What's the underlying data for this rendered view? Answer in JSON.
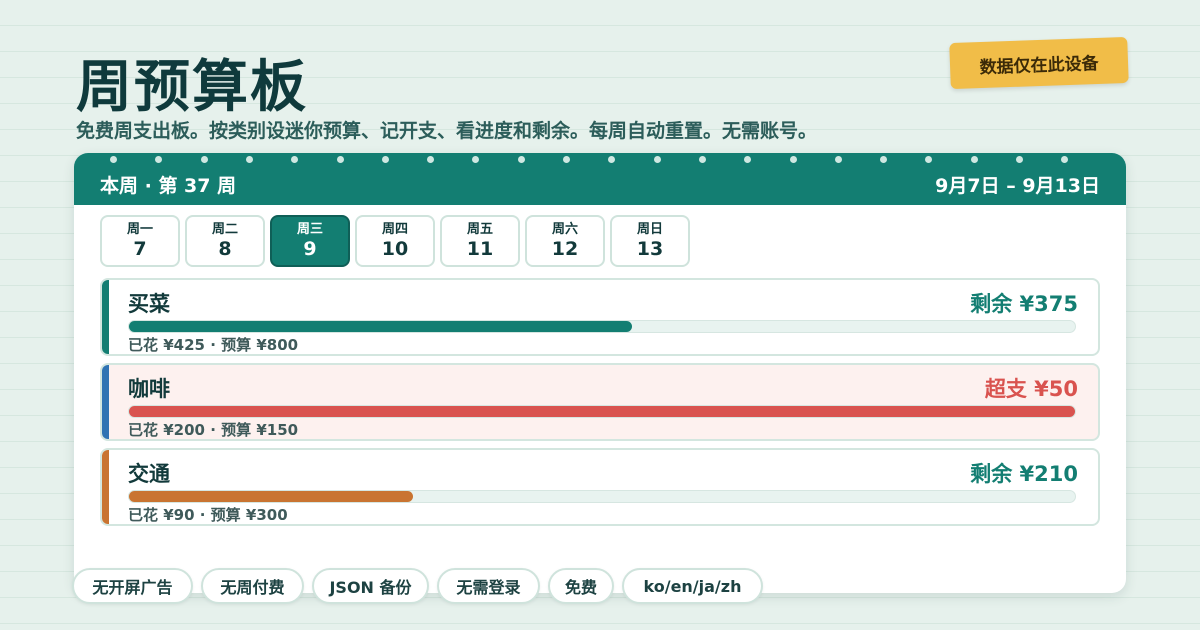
{
  "app": {
    "title": "周预算板",
    "subtitle": "免费周支出板。按类别设迷你预算、记开支、看进度和剩余。每周自动重置。无需账号。",
    "badge": "数据仅在此设备"
  },
  "header": {
    "week_label": "本周 · 第 37 周",
    "date_range": "9月7日 – 9月13日"
  },
  "days": [
    {
      "name": "周一",
      "num": "7",
      "active": false
    },
    {
      "name": "周二",
      "num": "8",
      "active": false
    },
    {
      "name": "周三",
      "num": "9",
      "active": true
    },
    {
      "name": "周四",
      "num": "10",
      "active": false
    },
    {
      "name": "周五",
      "num": "11",
      "active": false
    },
    {
      "name": "周六",
      "num": "12",
      "active": false
    },
    {
      "name": "周日",
      "num": "13",
      "active": false
    }
  ],
  "categories": [
    {
      "name": "买菜",
      "status": "剩余 ¥375",
      "meta": "已花 ¥425 · 预算 ¥800",
      "spent": 425,
      "budget": 800,
      "over": false,
      "accent": "#137e72",
      "status_color": "#137e72"
    },
    {
      "name": "咖啡",
      "status": "超支 ¥50",
      "meta": "已花 ¥200 · 预算 ¥150",
      "spent": 200,
      "budget": 150,
      "over": true,
      "accent": "#d9534f",
      "stripe": "#2f73b3",
      "status_color": "#d9534f"
    },
    {
      "name": "交通",
      "status": "剩余 ¥210",
      "meta": "已花 ¥90 · 预算 ¥300",
      "spent": 90,
      "budget": 300,
      "over": false,
      "accent": "#c97431",
      "status_color": "#137e72"
    }
  ],
  "chips": [
    "无开屏广告",
    "无周付费",
    "JSON 备份",
    "无需登录",
    "免费",
    "ko/en/ja/zh"
  ],
  "colors": {
    "primary": "#137e72",
    "over": "#d9534f",
    "badge": "#f1bd48",
    "coffee_stripe": "#2f73b3",
    "transport": "#c97431"
  }
}
